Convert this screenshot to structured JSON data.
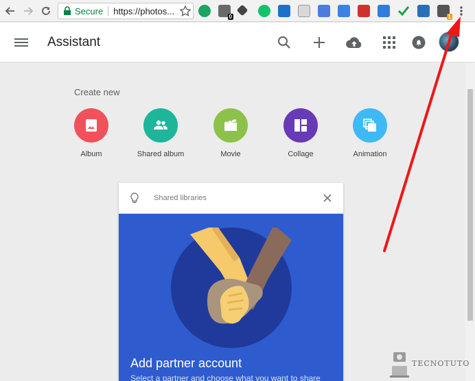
{
  "browser": {
    "secure_label": "Secure",
    "url": "https://photos...",
    "extension_badges": [
      "0",
      "1"
    ]
  },
  "app": {
    "title": "Assistant"
  },
  "create_new": {
    "heading": "Create new",
    "items": [
      {
        "label": "Album",
        "color": "#f1515b"
      },
      {
        "label": "Shared album",
        "color": "#1fb59a"
      },
      {
        "label": "Movie",
        "color": "#8cc24a"
      },
      {
        "label": "Collage",
        "color": "#673ab7"
      },
      {
        "label": "Animation",
        "color": "#3fb9f5"
      }
    ]
  },
  "card": {
    "header": "Shared libraries",
    "title": "Add partner account",
    "subtitle": "Select a partner and choose what you want to share"
  },
  "watermark": {
    "text": "TECNOTUTO"
  },
  "colors": {
    "card_blue": "#2e5bce",
    "card_circle": "#1f3a9a",
    "annotation_arrow": "#f01616"
  }
}
